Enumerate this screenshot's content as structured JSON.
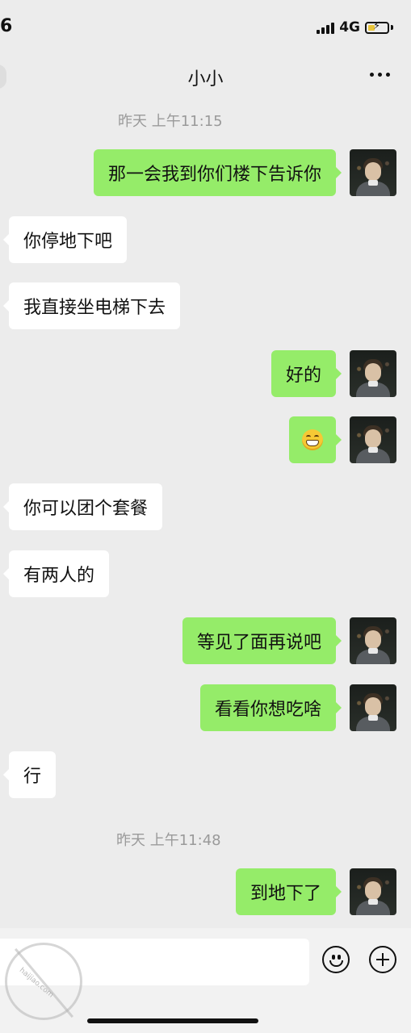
{
  "status_bar": {
    "time": "6",
    "network": "4G",
    "icons": [
      "signal-icon",
      "battery-charging-icon"
    ]
  },
  "nav": {
    "title": "小小",
    "more_icon": "more-icon"
  },
  "chat": {
    "timestamps": [
      "昨天 上午11:15",
      "昨天 上午11:48"
    ],
    "messages": [
      {
        "side": "right",
        "text": "那一会我到你们楼下告诉你"
      },
      {
        "side": "left",
        "text": "你停地下吧"
      },
      {
        "side": "left",
        "text": "我直接坐电梯下去"
      },
      {
        "side": "right",
        "text": "好的"
      },
      {
        "side": "right",
        "emoji": "grinning-emoji"
      },
      {
        "side": "left",
        "text": "你可以团个套餐"
      },
      {
        "side": "left",
        "text": "有两人的"
      },
      {
        "side": "right",
        "text": "等见了面再说吧"
      },
      {
        "side": "right",
        "text": "看看你想吃啥"
      },
      {
        "side": "left",
        "text": "行"
      },
      {
        "side": "right",
        "text": "到地下了"
      }
    ]
  },
  "input_bar": {
    "icons": [
      "emoji-icon",
      "plus-icon"
    ]
  },
  "watermark": {
    "text": "haijiao.com"
  },
  "colors": {
    "background": "#ececec",
    "bubble_right": "#95ec69",
    "bubble_left": "#ffffff",
    "timestamp": "#9a9a9a"
  }
}
